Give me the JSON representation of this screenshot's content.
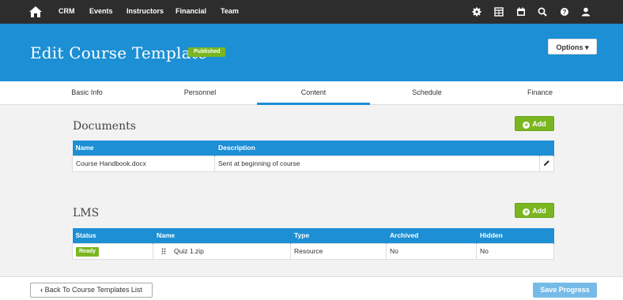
{
  "nav": {
    "links": [
      "CRM",
      "Events",
      "Instructors",
      "Financial",
      "Team"
    ],
    "icons": [
      "gear-icon",
      "calendar-grid-icon",
      "calendar-icon",
      "search-icon",
      "help-icon",
      "user-icon"
    ]
  },
  "header": {
    "title": "Edit Course Template",
    "status_badge": "Published",
    "options_label": "Options ▾"
  },
  "tabs": [
    {
      "label": "Basic Info"
    },
    {
      "label": "Personnel"
    },
    {
      "label": "Content"
    },
    {
      "label": "Schedule"
    },
    {
      "label": "Finance"
    }
  ],
  "documents": {
    "title": "Documents",
    "add_label": "Add",
    "columns": [
      "Name",
      "Description"
    ],
    "rows": [
      {
        "name": "Course Handbook.docx",
        "description": "Sent at beginning of course"
      }
    ]
  },
  "lms": {
    "title": "LMS",
    "add_label": "Add",
    "columns": [
      "Status",
      "Name",
      "Type",
      "Archived",
      "Hidden"
    ],
    "rows": [
      {
        "status": "Ready",
        "name": "Quiz 1.zip",
        "type": "Resource",
        "archived": "No",
        "hidden": "No"
      }
    ]
  },
  "footer": {
    "back_label": "Back To Course Templates List",
    "save_label": "Save Progress"
  },
  "colors": {
    "brand_blue": "#1d8fd4",
    "success_green": "#7ab620",
    "nav_dark": "#2d2d2d"
  }
}
